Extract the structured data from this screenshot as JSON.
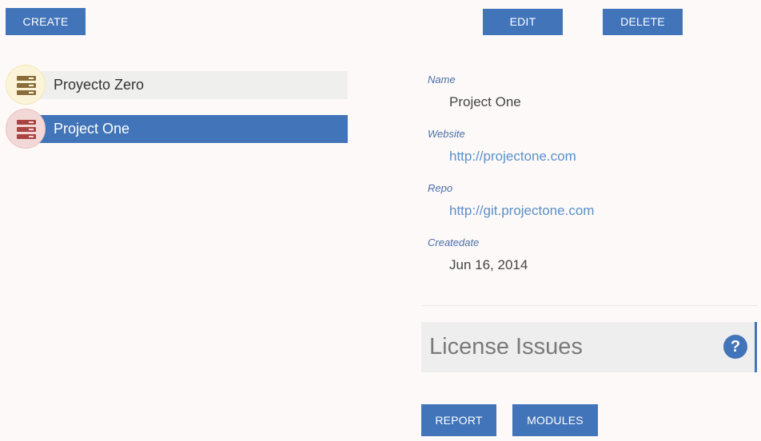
{
  "toolbar": {
    "create_label": "CREATE",
    "edit_label": "EDIT",
    "delete_label": "DELETE"
  },
  "projects": [
    {
      "name": "Proyecto Zero",
      "icon": "server-icon",
      "icon_color": "#8a6d3b",
      "selected": false
    },
    {
      "name": "Project One",
      "icon": "server-icon",
      "icon_color": "#a94442",
      "selected": true
    }
  ],
  "details": {
    "name_label": "Name",
    "name_value": "Project One",
    "website_label": "Website",
    "website_value": "http://projectone.com",
    "repo_label": "Repo",
    "repo_value": "http://git.projectone.com",
    "createdate_label": "Createdate",
    "createdate_value": "Jun 16, 2014"
  },
  "license": {
    "title": "License Issues",
    "help_icon": "question-icon",
    "help_glyph": "?"
  },
  "actions": {
    "report_label": "REPORT",
    "modules_label": "MODULES"
  },
  "colors": {
    "accent": "#4174b9",
    "background": "#fdf9f8",
    "link": "#5a8fcc"
  }
}
